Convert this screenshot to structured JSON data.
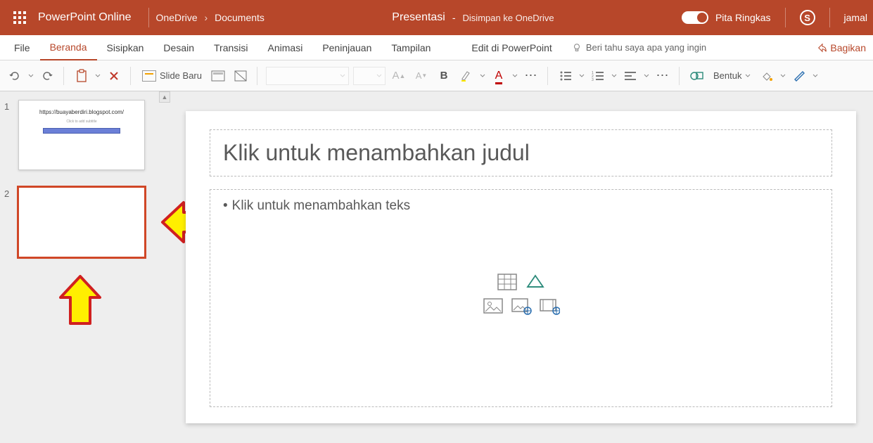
{
  "header": {
    "app_name": "PowerPoint Online",
    "breadcrumb_root": "OneDrive",
    "breadcrumb_folder": "Documents",
    "doc_name": "Presentasi",
    "save_status": "Disimpan ke OneDrive",
    "toggle_label": "Pita Ringkas",
    "skype_letter": "S",
    "user_name": "jamal"
  },
  "tabs": {
    "file": "File",
    "home": "Beranda",
    "insert": "Sisipkan",
    "design": "Desain",
    "transitions": "Transisi",
    "animations": "Animasi",
    "review": "Peninjauan",
    "view": "Tampilan",
    "edit_desktop": "Edit di PowerPoint",
    "tell_me": "Beri tahu saya apa yang ingin",
    "share": "Bagikan"
  },
  "ribbon": {
    "new_slide": "Slide Baru",
    "shape_btn": "Bentuk"
  },
  "slides": {
    "s1_num": "1",
    "s1_url": "https://buayaberdiri.blogspot.com/",
    "s1_sub": "Click to add subtitle",
    "s2_num": "2"
  },
  "editor": {
    "title_placeholder": "Klik untuk menambahkan judul",
    "body_placeholder": "Klik untuk menambahkan teks"
  }
}
